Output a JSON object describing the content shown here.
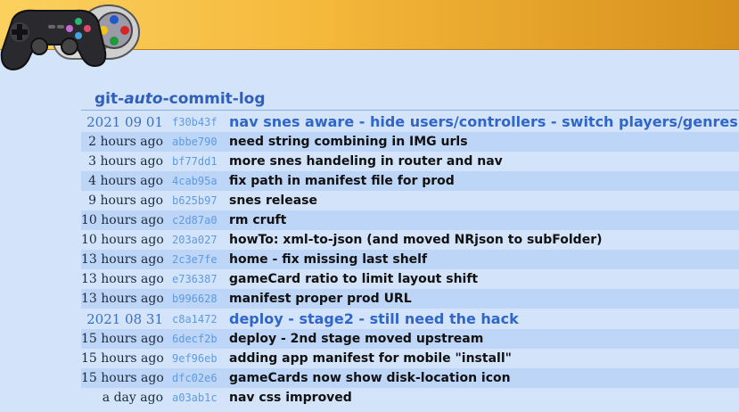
{
  "header": {
    "title_prefix": "git-",
    "title_emphasis": "auto",
    "title_suffix": "-commit-log",
    "logo_icon": "gamepad-and-snes-controller-icon"
  },
  "commits": [
    {
      "when": "2021 09 01",
      "hash": "f30b43f",
      "message": "nav snes aware - hide users/controllers - switch players/genres",
      "is_date_header": true
    },
    {
      "when": "2 hours ago",
      "hash": "abbe790",
      "message": "need string combining in IMG urls",
      "is_date_header": false
    },
    {
      "when": "3 hours ago",
      "hash": "bf77dd1",
      "message": "more snes handeling in router and nav",
      "is_date_header": false
    },
    {
      "when": "4 hours ago",
      "hash": "4cab95a",
      "message": "fix path in manifest file for prod",
      "is_date_header": false
    },
    {
      "when": "9 hours ago",
      "hash": "b625b97",
      "message": "snes release",
      "is_date_header": false
    },
    {
      "when": "10 hours ago",
      "hash": "c2d87a0",
      "message": "rm cruft",
      "is_date_header": false
    },
    {
      "when": "10 hours ago",
      "hash": "203a027",
      "message": "howTo: xml-to-json (and moved NRjson to subFolder)",
      "is_date_header": false
    },
    {
      "when": "13 hours ago",
      "hash": "2c3e7fe",
      "message": "home - fix missing last shelf",
      "is_date_header": false
    },
    {
      "when": "13 hours ago",
      "hash": "e736387",
      "message": "gameCard ratio to limit layout shift",
      "is_date_header": false
    },
    {
      "when": "13 hours ago",
      "hash": "b996628",
      "message": "manifest proper prod URL",
      "is_date_header": false
    },
    {
      "when": "2021 08 31",
      "hash": "c8a1472",
      "message": "deploy - stage2 - still need the hack",
      "is_date_header": true
    },
    {
      "when": "15 hours ago",
      "hash": "6decf2b",
      "message": "deploy - 2nd stage moved upstream",
      "is_date_header": false
    },
    {
      "when": "15 hours ago",
      "hash": "9ef96eb",
      "message": "adding app manifest for mobile \"install\"",
      "is_date_header": false
    },
    {
      "when": "15 hours ago",
      "hash": "dfc02e6",
      "message": "gameCards now show disk-location icon",
      "is_date_header": false
    },
    {
      "when": "a day ago",
      "hash": "a03ab1c",
      "message": "nav css improved",
      "is_date_header": false
    }
  ]
}
